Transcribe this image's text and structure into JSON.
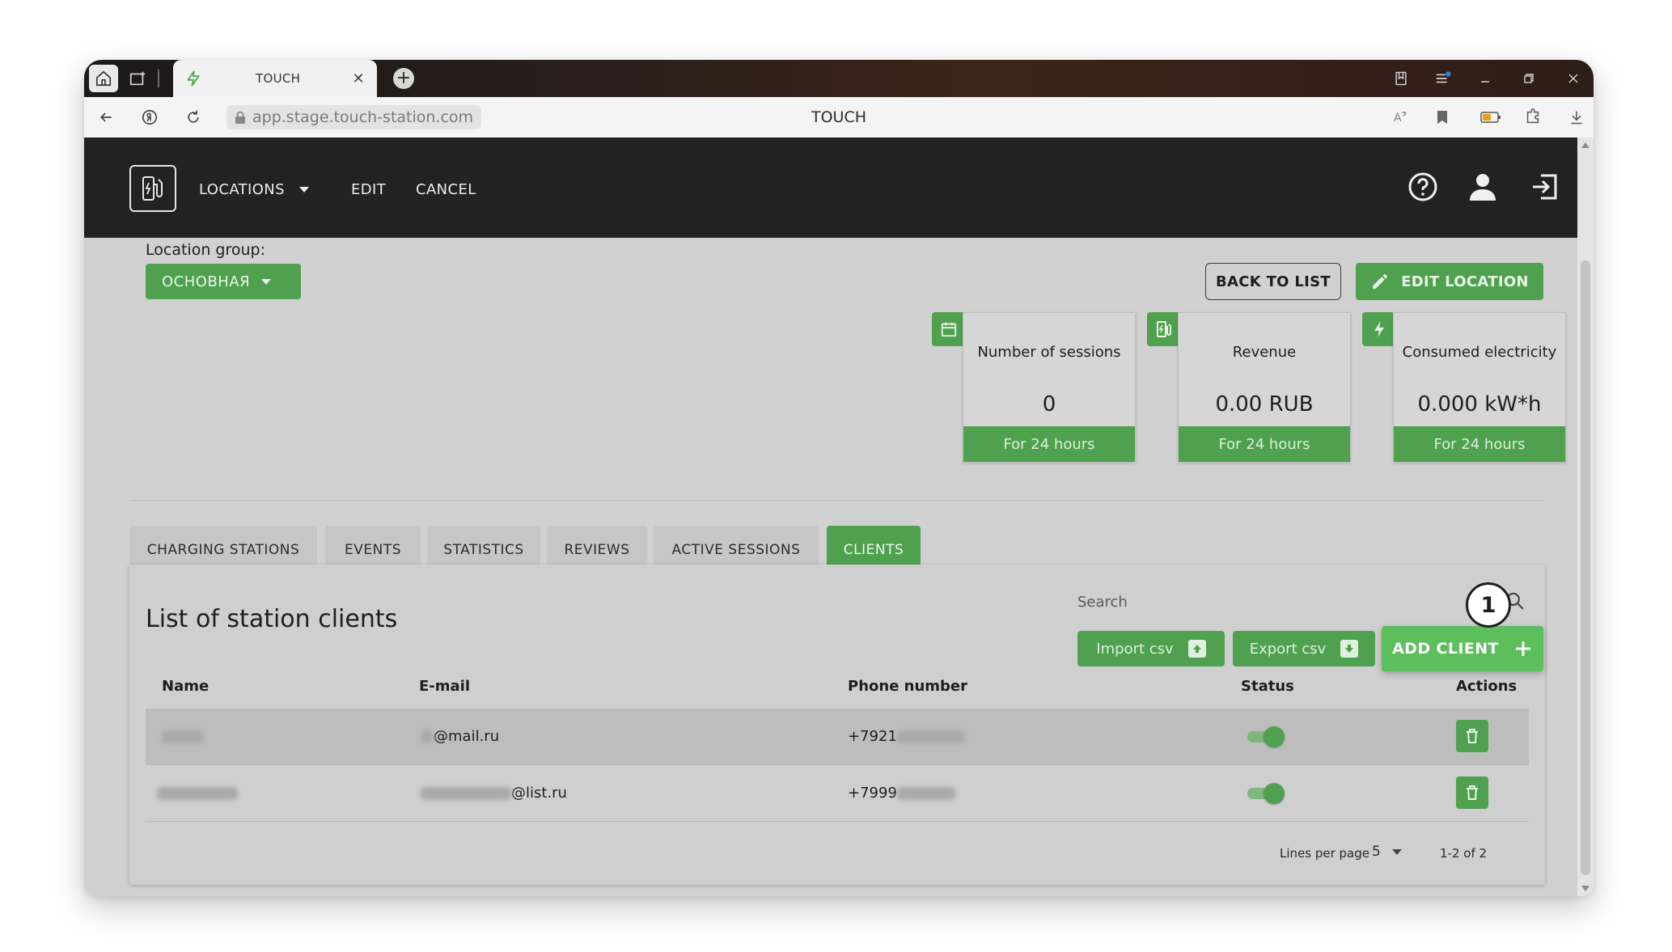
{
  "browser": {
    "tab_title": "TOUCH",
    "url": "app.stage.touch-station.com",
    "page_title": "TOUCH"
  },
  "appbar": {
    "nav_locations": "LOCATIONS",
    "nav_edit": "EDIT",
    "nav_cancel": "CANCEL"
  },
  "location": {
    "group_label": "Location group:",
    "group_value": "ОСНОВНАЯ",
    "back_button": "BACK TO LIST",
    "edit_button": "EDIT LOCATION"
  },
  "stats": [
    {
      "title": "Number of sessions",
      "value": "0",
      "period": "For 24 hours",
      "icon": "calendar-icon"
    },
    {
      "title": "Revenue",
      "value": "0.00 RUB",
      "period": "For 24 hours",
      "icon": "fuel-station-icon"
    },
    {
      "title": "Consumed electricity",
      "value": "0.000 kW*h",
      "period": "For 24 hours",
      "icon": "bolt-icon"
    }
  ],
  "tabs": [
    {
      "label": "CHARGING STATIONS"
    },
    {
      "label": "EVENTS"
    },
    {
      "label": "STATISTICS"
    },
    {
      "label": "REVIEWS"
    },
    {
      "label": "ACTIVE SESSIONS"
    },
    {
      "label": "CLIENTS"
    }
  ],
  "clients": {
    "title": "List of station clients",
    "search_label": "Search",
    "import_label": "Import csv",
    "export_label": "Export csv",
    "add_label": "ADD CLIENT",
    "columns": [
      "Name",
      "E-mail",
      "Phone number",
      "Status",
      "Actions"
    ],
    "rows": [
      {
        "email_suffix": "@mail.ru",
        "phone_prefix": "+7921",
        "status": "on"
      },
      {
        "email_suffix": "@list.ru",
        "phone_prefix": "+7999",
        "status": "on"
      }
    ],
    "lines_per_page_label": "Lines per page",
    "lines_per_page_value": "5",
    "range": "1-2 of 2"
  },
  "annotation": {
    "number": "1"
  },
  "colors": {
    "accent_green": "#4fa14f",
    "appbar_dark": "#222222",
    "page_gray": "#d1d1d1"
  }
}
